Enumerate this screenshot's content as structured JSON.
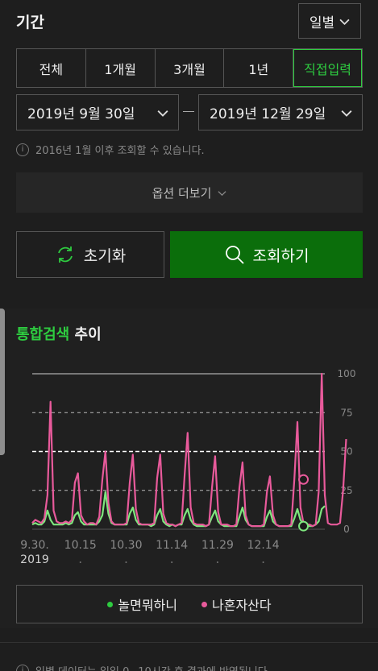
{
  "period": {
    "title": "기간",
    "unit": "일별"
  },
  "range_tabs": [
    {
      "label": "전체",
      "active": false
    },
    {
      "label": "1개월",
      "active": false
    },
    {
      "label": "3개월",
      "active": false
    },
    {
      "label": "1년",
      "active": false
    },
    {
      "label": "직접입력",
      "active": true
    }
  ],
  "date_range": {
    "start": "2019년 9월 30일",
    "end": "2019년 12월 29일"
  },
  "notice": "2016년 1월 이후 조회할 수 있습니다.",
  "more_options": "옵션 더보기",
  "buttons": {
    "reset": "초기화",
    "search": "조회하기"
  },
  "trend": {
    "title_highlight": "통합검색",
    "title_rest": "추이"
  },
  "colors": {
    "accent": "#2ecc40",
    "primary_button": "#0b6e0b",
    "series_a": "#7ee67e",
    "series_b": "#e85a9b"
  },
  "chart_data": {
    "type": "line",
    "ylim": [
      0,
      100
    ],
    "yticks": [
      0,
      25,
      50,
      75,
      100
    ],
    "x_tick_labels": [
      "9.30.",
      "10.15",
      "10.30",
      "11.14",
      "11.29",
      "12.14"
    ],
    "x_sublabel": "2019",
    "grid": true,
    "legend_position": "bottom",
    "series": [
      {
        "name": "놀면뭐하니",
        "color": "#7ee67e",
        "values": [
          3,
          4,
          3,
          3,
          5,
          12,
          6,
          3,
          3,
          3,
          3,
          4,
          3,
          4,
          9,
          11,
          5,
          3,
          3,
          3,
          3,
          3,
          5,
          9,
          24,
          10,
          4,
          3,
          3,
          3,
          3,
          3,
          10,
          14,
          6,
          3,
          3,
          3,
          3,
          2,
          3,
          9,
          13,
          5,
          3,
          2,
          3,
          2,
          3,
          3,
          9,
          13,
          6,
          3,
          2,
          2,
          2,
          2,
          3,
          8,
          12,
          5,
          3,
          2,
          2,
          2,
          2,
          2,
          8,
          14,
          6,
          3,
          2,
          2,
          2,
          2,
          2,
          8,
          12,
          5,
          3,
          2,
          2,
          2,
          2,
          2,
          7,
          13,
          6,
          3,
          2,
          2,
          2,
          3,
          5,
          13,
          15
        ]
      },
      {
        "name": "나혼자산다",
        "color": "#e85a9b",
        "values": [
          4,
          6,
          5,
          4,
          7,
          22,
          82,
          12,
          5,
          4,
          4,
          5,
          4,
          6,
          30,
          36,
          9,
          5,
          3,
          4,
          4,
          3,
          8,
          32,
          50,
          17,
          5,
          3,
          3,
          3,
          3,
          4,
          30,
          48,
          13,
          4,
          3,
          3,
          3,
          3,
          4,
          33,
          48,
          10,
          4,
          3,
          3,
          2,
          3,
          4,
          35,
          62,
          14,
          4,
          3,
          3,
          3,
          2,
          3,
          27,
          47,
          11,
          3,
          3,
          3,
          2,
          2,
          3,
          27,
          43,
          9,
          3,
          2,
          2,
          2,
          2,
          3,
          24,
          34,
          9,
          3,
          2,
          2,
          2,
          2,
          3,
          32,
          69,
          14,
          4,
          3,
          3,
          2,
          3,
          24,
          100,
          22,
          4,
          3,
          3,
          3,
          4,
          25,
          58
        ]
      }
    ],
    "highlight_points": [
      {
        "series": "나혼자산다",
        "index": 89,
        "value": 32
      },
      {
        "series": "놀면뭐하니",
        "index": 89,
        "value": 2
      }
    ]
  },
  "footer_note": "일별 데이터는 일일 0~10시간 후 결과에 반영됩니다."
}
